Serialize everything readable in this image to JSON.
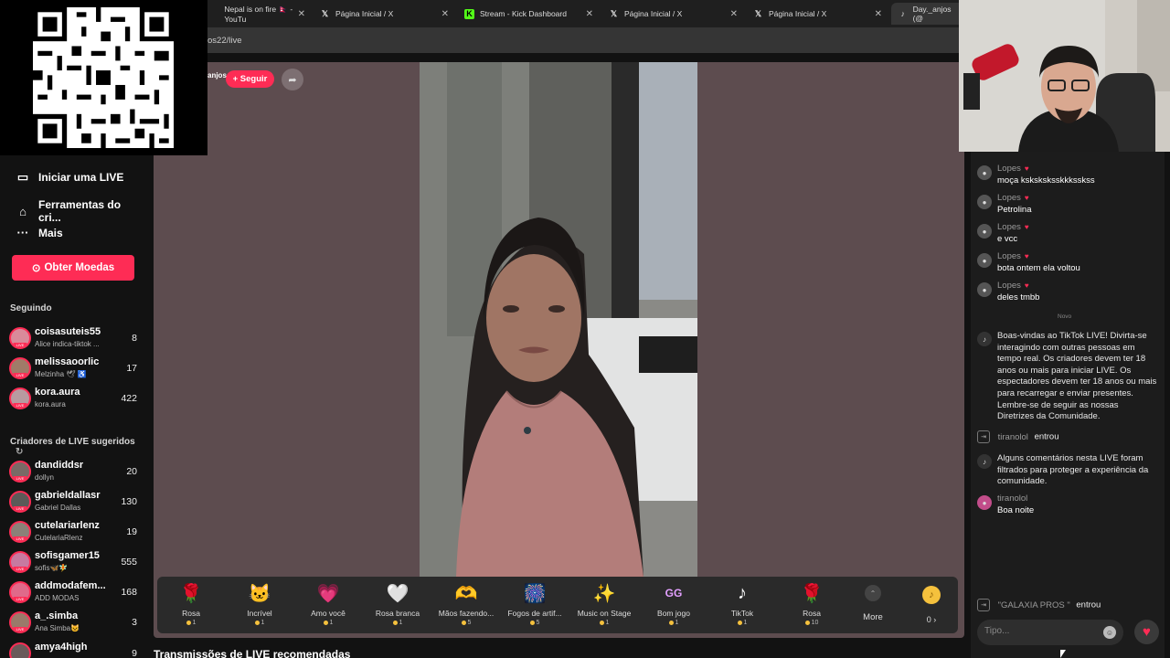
{
  "browser": {
    "tabs": [
      {
        "title": "Nepal is on fire 🇳🇵 - YouTu",
        "icon": "youtube-icon"
      },
      {
        "title": "Página Inicial / X",
        "icon": "x-logo-icon"
      },
      {
        "title": "Stream - Kick Dashboard",
        "icon": "kick-icon"
      },
      {
        "title": "Página Inicial / X",
        "icon": "x-logo-icon"
      },
      {
        "title": "Página Inicial / X",
        "icon": "x-logo-icon"
      },
      {
        "title": "Day._anjos (@",
        "icon": "tiktok-icon"
      }
    ],
    "url": "os22/live"
  },
  "sidebar": {
    "nav": [
      {
        "label": "Iniciar uma LIVE",
        "icon": "camera-icon"
      },
      {
        "label": "Ferramentas do cri...",
        "icon": "home-bulb-icon"
      },
      {
        "label": "Mais",
        "icon": "more-dots-icon"
      }
    ],
    "coins_button": "Obter Moedas",
    "following_title": "Seguindo",
    "following": [
      {
        "name": "coisasuteis55",
        "sub": "Alice indica-tiktok ...",
        "count": "8"
      },
      {
        "name": "melissaoorlic",
        "sub": "Melzinha 🕊 ♿",
        "count": "17"
      },
      {
        "name": "kora.aura",
        "sub": "kora.aura",
        "count": "422"
      }
    ],
    "suggested_title": "Criadores de LIVE sugeridos",
    "suggested": [
      {
        "name": "dandiddsr",
        "sub": "dollyn",
        "count": "20"
      },
      {
        "name": "gabrieldallasr",
        "sub": "Gabriel Dallas",
        "count": "130"
      },
      {
        "name": "cutelariarlenz",
        "sub": "CutelariaRlenz",
        "count": "19"
      },
      {
        "name": "sofisgamer15",
        "sub": "sofis🦋🧚",
        "count": "555"
      },
      {
        "name": "addmodafem...",
        "sub": "ADD MODAS",
        "count": "168"
      },
      {
        "name": "a_.simba",
        "sub": "Ana Simba😺",
        "count": "3"
      },
      {
        "name": "amya4high",
        "sub": "",
        "count": "9"
      }
    ]
  },
  "stream": {
    "host": "anjos",
    "follow_label": "+ Seguir"
  },
  "gifts": [
    {
      "name": "Rosa",
      "price": "1",
      "icon": "🌹"
    },
    {
      "name": "Incrível",
      "price": "1",
      "icon": "🐱"
    },
    {
      "name": "Amo você",
      "price": "1",
      "icon": "💗"
    },
    {
      "name": "Rosa branca",
      "price": "1",
      "icon": "🤍"
    },
    {
      "name": "Mãos fazendo...",
      "price": "5",
      "icon": "🫶"
    },
    {
      "name": "Fogos de artif...",
      "price": "5",
      "icon": "🎆"
    },
    {
      "name": "Music on Stage",
      "price": "1",
      "icon": "✨"
    },
    {
      "name": "Bom jogo",
      "price": "1",
      "icon": "GG"
    },
    {
      "name": "TikTok",
      "price": "1",
      "icon": "♪"
    },
    {
      "name": "Rosa",
      "price": "10",
      "icon": "🌹"
    }
  ],
  "gift_more_label": "More",
  "coin_balance": "0 ›",
  "recommended_title": "Transmissões de LIVE recomendadas",
  "chat": {
    "messages": [
      {
        "user": "Lopes",
        "text": "moça ksksksksskkksskss"
      },
      {
        "user": "Lopes",
        "text": "Petrolina"
      },
      {
        "user": "Lopes",
        "text": "e vcc"
      },
      {
        "user": "Lopes",
        "text": "bota ontem ela voltou"
      },
      {
        "user": "Lopes",
        "text": "deles tmbb"
      }
    ],
    "new_divider": "Novo",
    "system_welcome": "Boas-vindas ao TikTok LIVE! Divirta-se interagindo com outras pessoas em tempo real. Os criadores devem ter 18 anos ou mais para iniciar LIVE. Os espectadores devem ter 18 anos ou mais para recarregar e enviar presentes. Lembre-se de seguir as nossas Diretrizes da Comunidade.",
    "join1_name": "tiranolol",
    "join1_text": "entrou",
    "system_filter": "Alguns comentários nesta LIVE foram filtrados para proteger a experiência da comunidade.",
    "last_user": "tiranolol",
    "last_text": "Boa noite",
    "join2_name": "\"GALAXIA PROS \"",
    "join2_text": "entrou",
    "input_placeholder": "Tipo..."
  },
  "colors": {
    "accent": "#fe2c55",
    "background": "#121212",
    "player_bg": "#5d4c4f",
    "coin": "#f5c13d"
  }
}
